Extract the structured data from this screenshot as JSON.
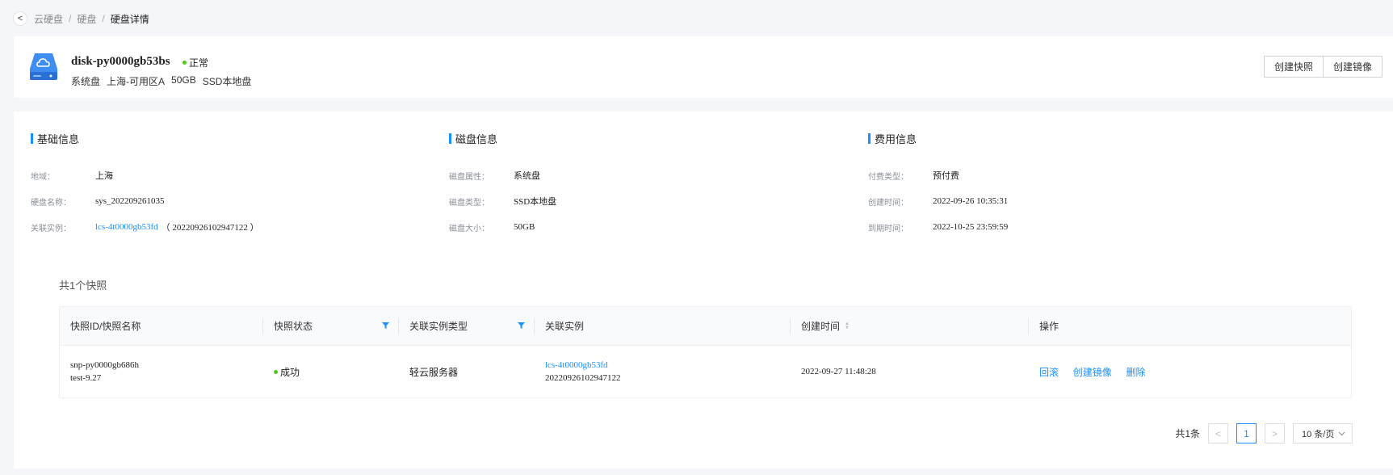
{
  "breadcrumb": {
    "back": "<",
    "items": [
      "云硬盘",
      "硬盘"
    ],
    "current": "硬盘详情",
    "sep": "/"
  },
  "header": {
    "name": "disk-py0000gb53bs",
    "status": "正常",
    "status_color": "#52c41a",
    "meta": [
      "系统盘",
      "上海-可用区A",
      "50GB",
      "SSD本地盘"
    ],
    "actions": [
      "创建快照",
      "创建镜像"
    ]
  },
  "basic": {
    "title": "基础信息",
    "rows": [
      {
        "label": "地域：",
        "value": "上海"
      },
      {
        "label": "硬盘名称：",
        "value": "sys_202209261035"
      },
      {
        "label": "关联实例：",
        "link": "lcs-4t0000gb53fd",
        "extra": "（ 20220926102947122 ）"
      }
    ]
  },
  "disk": {
    "title": "磁盘信息",
    "rows": [
      {
        "label": "磁盘属性：",
        "value": "系统盘"
      },
      {
        "label": "磁盘类型：",
        "value": "SSD本地盘"
      },
      {
        "label": "磁盘大小：",
        "value": "50GB"
      }
    ]
  },
  "cost": {
    "title": "费用信息",
    "rows": [
      {
        "label": "付费类型：",
        "value": "预付费"
      },
      {
        "label": "创建时间：",
        "value": "2022-09-26 10:35:31"
      },
      {
        "label": "到期时间：",
        "value": "2022-10-25 23:59:59"
      }
    ]
  },
  "snapshots": {
    "count_label": "共1个快照",
    "columns": [
      "快照ID/快照名称",
      "快照状态",
      "关联实例类型",
      "关联实例",
      "创建时间",
      "操作"
    ],
    "rows": [
      {
        "id": "snp-py0000gb686h",
        "name": "test-9.27",
        "status": "成功",
        "instance_type": "轻云服务器",
        "instance_link": "lcs-4t0000gb53fd",
        "instance_id": "20220926102947122",
        "created": "2022-09-27 11:48:28",
        "ops": [
          "回滚",
          "创建镜像",
          "删除"
        ]
      }
    ]
  },
  "pagination": {
    "total": "共1条",
    "prev": "<",
    "page": "1",
    "next": ">",
    "size": "10 条/页"
  },
  "colors": {
    "accent": "#1890ff",
    "success": "#52c41a"
  }
}
